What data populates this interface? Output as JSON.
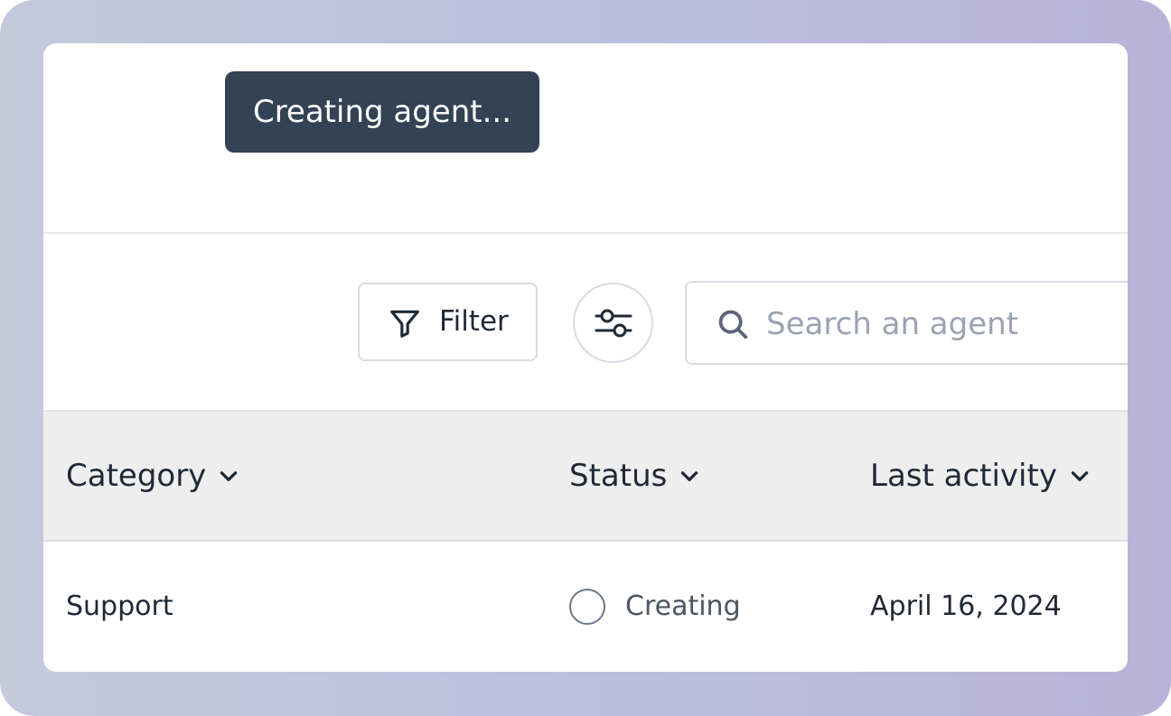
{
  "toast": {
    "message": "Creating agent..."
  },
  "toolbar": {
    "filter_label": "Filter",
    "filter_icon": "filter-funnel-icon",
    "settings_icon": "sliders-icon",
    "search_icon": "search-icon",
    "search_placeholder": "Search an agent",
    "search_value": ""
  },
  "table": {
    "columns": [
      {
        "label": "Category"
      },
      {
        "label": "Status"
      },
      {
        "label": "Last activity"
      }
    ],
    "rows": [
      {
        "category": "Support",
        "status": "Creating",
        "last_activity": "April 16, 2024"
      }
    ]
  },
  "colors": {
    "toast_bg": "#334254",
    "header_bg": "#eeeeee",
    "border": "#d8dbe2",
    "text": "#1f2937",
    "placeholder": "#9aa3b3"
  }
}
